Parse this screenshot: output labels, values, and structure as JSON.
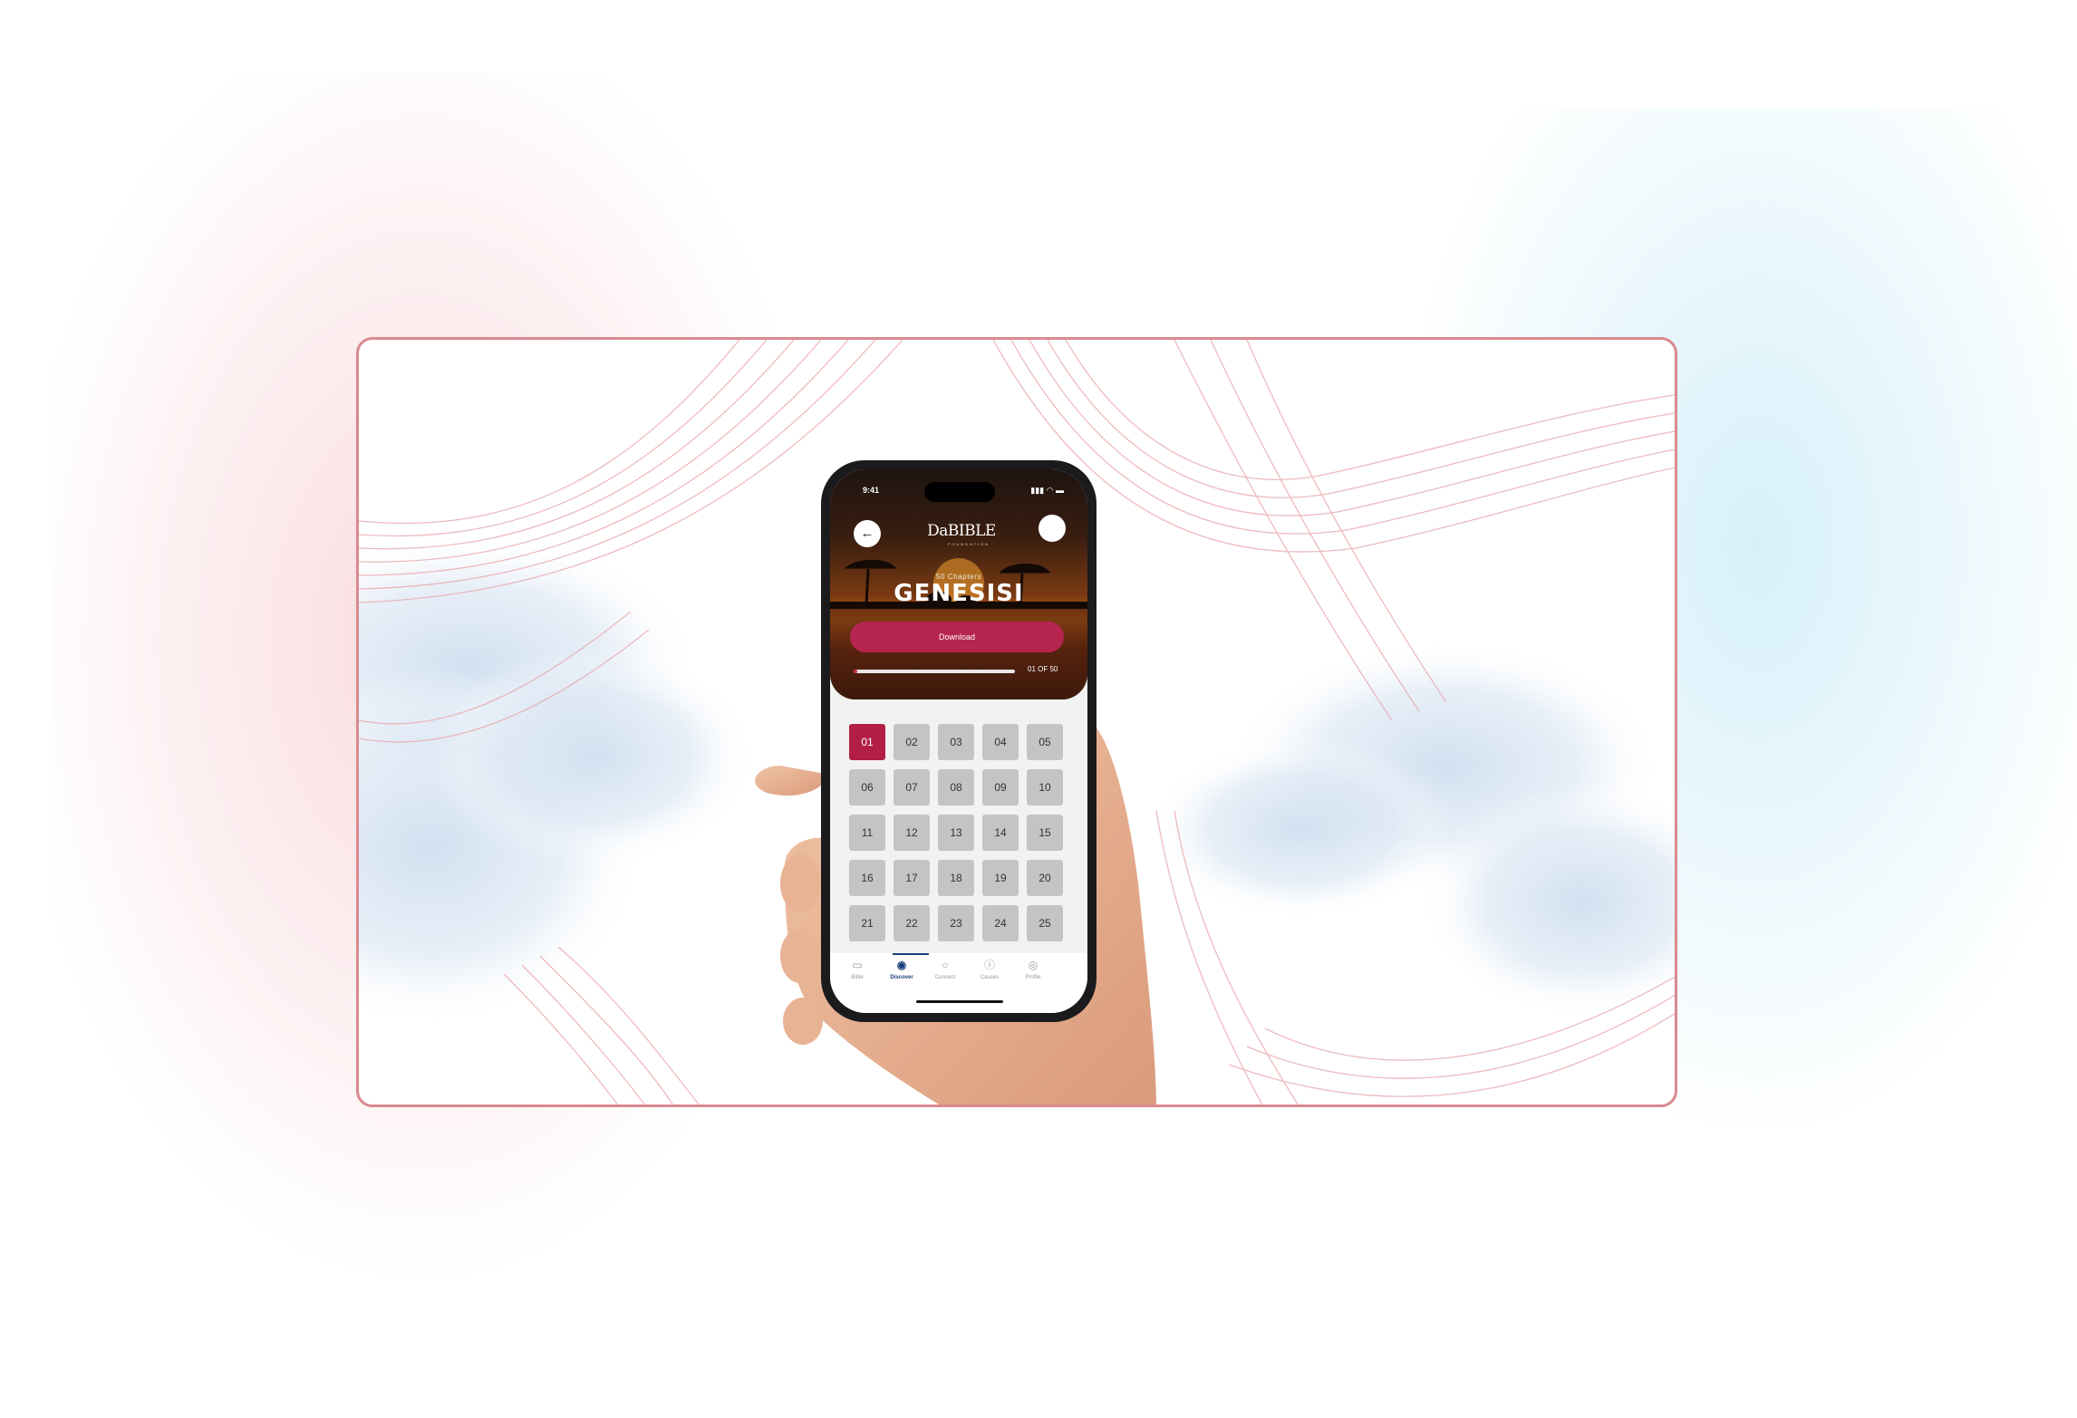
{
  "status_bar": {
    "time": "9:41",
    "icons": "▮▮▮ ◠ ▬"
  },
  "header": {
    "back_icon": "←",
    "logo_text": "DaBIBLE",
    "logo_subtext": "FOUNDATION"
  },
  "book": {
    "chapters_label": "50 Chapters",
    "title": "GENESISI",
    "download_label": "Download",
    "progress_label": "01 OF 50",
    "progress_fraction": 0.02
  },
  "chapter_grid": {
    "selected": "01",
    "chapters": [
      "01",
      "02",
      "03",
      "04",
      "05",
      "06",
      "07",
      "08",
      "09",
      "10",
      "11",
      "12",
      "13",
      "14",
      "15",
      "16",
      "17",
      "18",
      "19",
      "20",
      "21",
      "22",
      "23",
      "24",
      "25"
    ]
  },
  "tabbar": {
    "active": "Discover",
    "tabs": [
      {
        "label": "Bible",
        "icon": "bible-icon",
        "glyph": "▭"
      },
      {
        "label": "Discover",
        "icon": "compass-icon",
        "glyph": "◉"
      },
      {
        "label": "Connect",
        "icon": "chat-bubble-icon",
        "glyph": "○"
      },
      {
        "label": "Causes",
        "icon": "info-circle-icon",
        "glyph": "ⓘ"
      },
      {
        "label": "Profile",
        "icon": "profile-icon",
        "glyph": "◎"
      }
    ]
  },
  "colors": {
    "frame_border": "#d98a8f",
    "accent": "#b21e46",
    "tab_active": "#1c3f7a"
  }
}
